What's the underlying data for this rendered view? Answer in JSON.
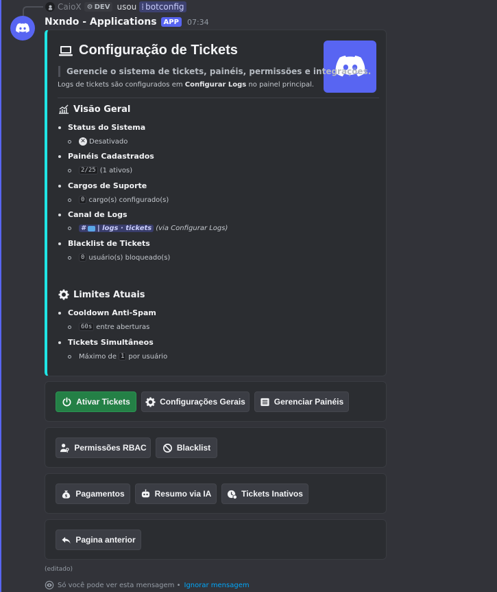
{
  "reply": {
    "user": "CaioX",
    "tag": "DEV",
    "used_text": "usou",
    "command": "botconfig"
  },
  "message": {
    "author": "Nxndo - Applications",
    "badge": "APP",
    "time": "07:34"
  },
  "embed": {
    "accent_color": "#1fe4e4",
    "title": "Configuração de Tickets",
    "quote": "Gerencie o sistema de tickets, painéis, permissões e integrações.",
    "logs_note_prefix": "Logs de tickets são configurados em",
    "logs_note_bold": "Configurar Logs",
    "logs_note_suffix": "no painel principal.",
    "overview": {
      "title": "Visão Geral",
      "status_label": "Status do Sistema",
      "status_value": "Desativado",
      "panels_label": "Painéis Cadastrados",
      "panels_code": "2/25",
      "panels_suffix": "(1 ativos)",
      "roles_label": "Cargos de Suporte",
      "roles_code": "0",
      "roles_suffix": "cargo(s) configurado(s)",
      "logs_label": "Canal de Logs",
      "logs_channel": "| logs · tickets",
      "logs_suffix": "(via Configurar Logs)",
      "blacklist_label": "Blacklist de Tickets",
      "blacklist_code": "0",
      "blacklist_suffix": "usuário(s) bloqueado(s)"
    },
    "limits": {
      "title": "Limites Atuais",
      "cooldown_label": "Cooldown Anti-Spam",
      "cooldown_code": "60s",
      "cooldown_suffix": "entre aberturas",
      "simul_label": "Tickets Simultâneos",
      "simul_prefix": "Máximo de",
      "simul_code": "1",
      "simul_suffix": "por usuário"
    }
  },
  "buttons": {
    "row1": [
      "Ativar Tickets",
      "Configurações Gerais",
      "Gerenciar Painéis"
    ],
    "row2": [
      "Permissões RBAC",
      "Blacklist"
    ],
    "row3": [
      "Pagamentos",
      "Resumo via IA",
      "Tickets Inativos"
    ],
    "row4": [
      "Pagina anterior"
    ]
  },
  "footer": {
    "edited": "(editado)",
    "ephemeral_text": "Só você pode ver esta mensagem •",
    "dismiss": "Ignorar mensagem"
  }
}
